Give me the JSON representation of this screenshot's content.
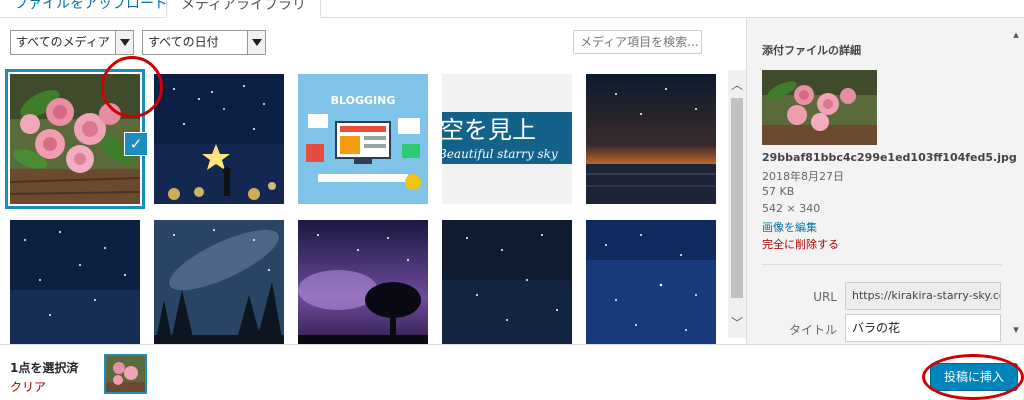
{
  "tabs": {
    "upload": "ファイルをアップロード",
    "library": "メディアライブラリ"
  },
  "filters": {
    "type_selected": "すべてのメディア",
    "date_selected": "すべての日付",
    "search_placeholder": "メディア項目を検索..."
  },
  "grid": {
    "items": [
      {
        "subject": "pink roses on wooden table",
        "selected": true
      },
      {
        "subject": "girl reaching for star at night"
      },
      {
        "subject": "blogging illustration"
      },
      {
        "subject": "starry sky text banner",
        "text_ja": "空を見上",
        "text_en": "Beautiful starry sky"
      },
      {
        "subject": "night sky over sea"
      },
      {
        "subject": "night sky with stars"
      },
      {
        "subject": "milky way over forest"
      },
      {
        "subject": "tree under purple galaxy"
      },
      {
        "subject": "dark starry sky"
      },
      {
        "subject": "blue starry sky"
      }
    ],
    "blogging_label": "BLOGGING"
  },
  "details": {
    "heading": "添付ファイルの詳細",
    "filename": "29bbaf81bbc4c299e1ed103ff104fed5.jpg",
    "date": "2018年8月27日",
    "size": "57 KB",
    "dimensions": "542 × 340",
    "edit_link": "画像を編集",
    "delete_link": "完全に削除する",
    "url_label": "URL",
    "url_value": "https://kirakira-starry-sky.co",
    "title_label": "タイトル",
    "title_value": "バラの花"
  },
  "footer": {
    "selection_count": "1点を選択済",
    "clear_label": "クリア",
    "insert_button": "投稿に挿入"
  },
  "colors": {
    "accent": "#1e8cbe",
    "button": "#0085ba",
    "danger": "#aa0000",
    "annotation": "#d00000"
  }
}
